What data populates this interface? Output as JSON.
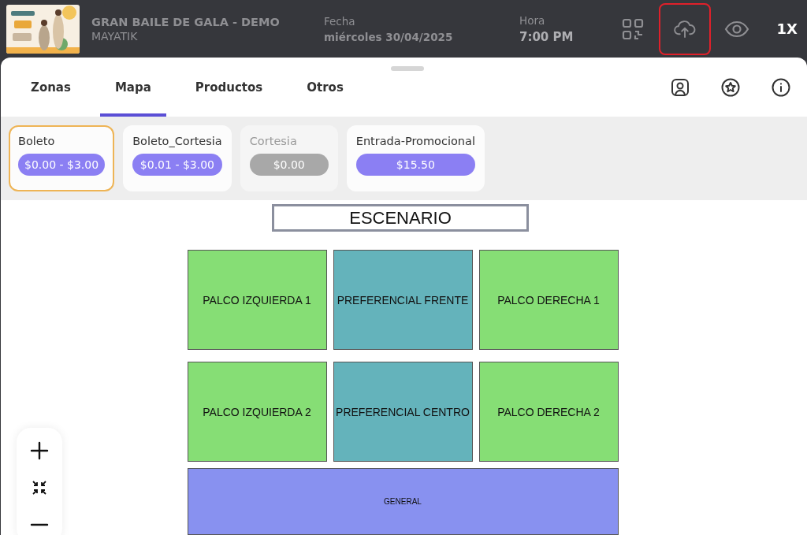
{
  "header": {
    "title": "GRAN BAILE DE GALA - DEMO",
    "organizer": "MAYATIK",
    "date_label": "Fecha",
    "date": "miércoles 30/04/2025",
    "time_label": "Hora",
    "time": "7:00 PM",
    "actions": [
      {
        "kind": "qr",
        "highlighted": false
      },
      {
        "kind": "upload",
        "highlighted": true
      },
      {
        "kind": "eye",
        "highlighted": false
      }
    ],
    "speed": "1X"
  },
  "tabs": [
    {
      "label": "Zonas",
      "selected": false
    },
    {
      "label": "Mapa",
      "selected": true
    },
    {
      "label": "Productos",
      "selected": false
    },
    {
      "label": "Otros",
      "selected": false
    }
  ],
  "tab_icons": [
    {
      "kind": "user"
    },
    {
      "kind": "star"
    },
    {
      "kind": "info"
    }
  ],
  "tickets": [
    {
      "name": "Boleto",
      "price": "$0.00 - $3.00",
      "selected": true,
      "disabled": false
    },
    {
      "name": "Boleto_Cortesia",
      "price": "$0.01 - $3.00",
      "selected": false,
      "disabled": false
    },
    {
      "name": "Cortesia",
      "price": "$0.00",
      "selected": false,
      "disabled": true
    },
    {
      "name": "Entrada-Promocional",
      "price": "$15.50",
      "selected": false,
      "disabled": false
    }
  ],
  "map": {
    "stage": "ESCENARIO",
    "zones": [
      {
        "label": "PALCO IZQUIERDA 1",
        "color": "#86de75",
        "kind": "box"
      },
      {
        "label": "PREFERENCIAL FRENTE",
        "color": "#64b3bb",
        "kind": "box"
      },
      {
        "label": "PALCO DERECHA 1",
        "color": "#86de75",
        "kind": "box"
      },
      {
        "label": "PALCO IZQUIERDA 2",
        "color": "#86de75",
        "kind": "box"
      },
      {
        "label": "PREFERENCIAL CENTRO",
        "color": "#64b3bb",
        "kind": "box"
      },
      {
        "label": "PALCO DERECHA 2",
        "color": "#86de75",
        "kind": "box"
      },
      {
        "label": "GENERAL",
        "color": "#8891f0",
        "kind": "wide"
      }
    ]
  },
  "zoom_controls": [
    {
      "kind": "zoom-in"
    },
    {
      "kind": "fit"
    },
    {
      "kind": "zoom-out"
    }
  ]
}
